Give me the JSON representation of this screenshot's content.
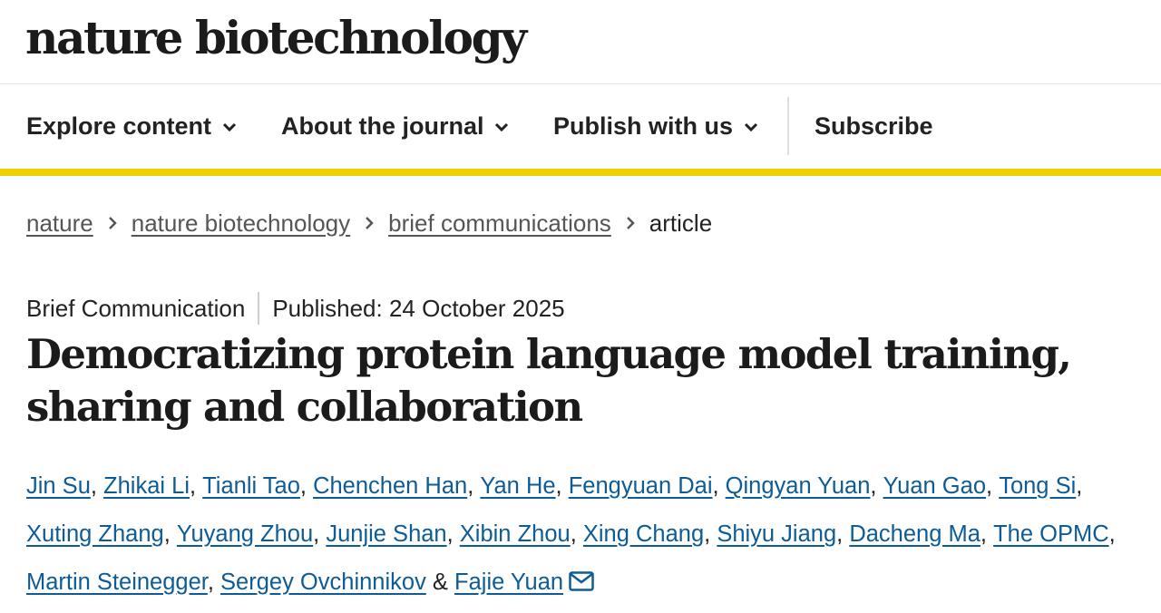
{
  "journal": {
    "name": "nature biotechnology"
  },
  "nav": {
    "items": [
      {
        "label": "Explore content",
        "icon": "chevron-down-icon"
      },
      {
        "label": "About the journal",
        "icon": "chevron-down-icon"
      },
      {
        "label": "Publish with us",
        "icon": "chevron-down-icon"
      }
    ],
    "subscribe": "Subscribe",
    "accent_color": "#eed100"
  },
  "breadcrumb": {
    "items": [
      "nature",
      "nature biotechnology",
      "brief communications"
    ],
    "current": "article",
    "separator_icon": "chevron-right-icon"
  },
  "article": {
    "type": "Brief Communication",
    "published": "Published: 24 October 2025",
    "title": "Democratizing protein language model training, sharing and collaboration",
    "authors": [
      "Jin Su",
      "Zhikai Li",
      "Tianli Tao",
      "Chenchen Han",
      "Yan He",
      "Fengyuan Dai",
      "Qingyan Yuan",
      "Yuan Gao",
      "Tong Si",
      "Xuting Zhang",
      "Yuyang Zhou",
      "Junjie Shan",
      "Xibin Zhou",
      "Xing Chang",
      "Shiyu Jiang",
      "Dacheng Ma",
      "The OPMC",
      "Martin Steinegger",
      "Sergey Ovchinnikov",
      "Fajie Yuan"
    ],
    "separators": {
      "comma": ", ",
      "ampersand": " & "
    },
    "corresponding_icon": "mail-icon",
    "link_color": "#0e5c97"
  }
}
